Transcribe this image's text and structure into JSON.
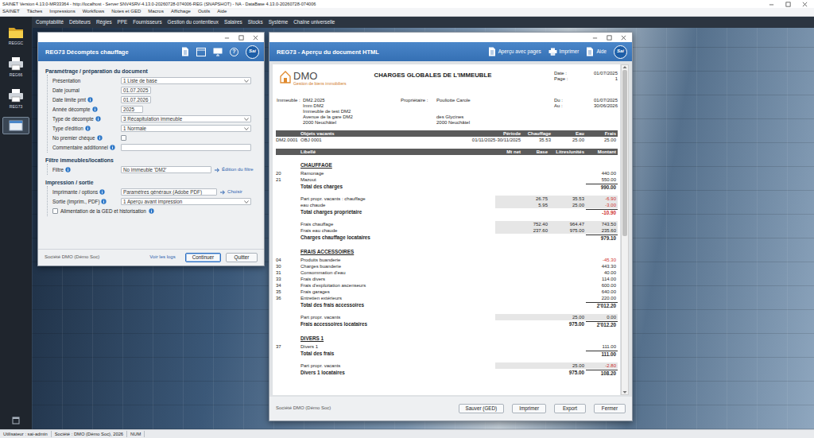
{
  "window": {
    "title": "SAINET Version 4.13.0-MR33364 - http://localhost - Server SNV4SRV-4.13.0-20260728-074006-REG (SNAPSHOT) - NA - DataBase 4.13.0-20260728-074006"
  },
  "menu_bar": [
    "SAINET",
    "Tâches",
    "Impressions",
    "Workflows",
    "Notes et GED",
    "Macros",
    "Affichage",
    "Outils",
    "Aide"
  ],
  "module_bar": [
    "Comptabilité",
    "Débiteurs",
    "Régies",
    "PPE",
    "Fournisseurs",
    "Gestion du contentieux",
    "Salaires",
    "Stocks",
    "Système",
    "Chaîne universelle"
  ],
  "sidebar": {
    "items": [
      {
        "label": "REGGC",
        "selected": false
      },
      {
        "label": "REG66",
        "selected": false
      },
      {
        "label": "REG73",
        "selected": false
      },
      {
        "selected": true
      }
    ]
  },
  "form_window": {
    "title": "REG73 Décomptes chauffage",
    "help_glyph": "?",
    "brand": "Sai",
    "sections": [
      {
        "title": "Paramétrage / préparation du document",
        "fields": [
          {
            "label": "Présentation",
            "info": false,
            "kind": "select",
            "value": "1 Liste de base"
          },
          {
            "label": "Date journal",
            "info": false,
            "kind": "date",
            "value": "01.07.2025"
          },
          {
            "label": "Date limite pmt",
            "info": true,
            "kind": "date",
            "value": "01.07.2026"
          },
          {
            "label": "Année décompte",
            "info": true,
            "kind": "year",
            "value": "2025"
          },
          {
            "label": "Type de décompte",
            "info": true,
            "kind": "select",
            "value": "3 Récapitulation immeuble"
          },
          {
            "label": "Type d'édition",
            "info": true,
            "kind": "select",
            "value": "1 Normale"
          },
          {
            "label": "No premier chèque",
            "info": true,
            "kind": "checkbox",
            "checked": false
          },
          {
            "label": "Commentaire additionnel",
            "info": true,
            "kind": "text"
          }
        ]
      },
      {
        "title": "Filtre immeubles/locations",
        "fields": [
          {
            "label": "Filtre",
            "info": true,
            "kind": "link-field",
            "value": "No immeuble 'DM2'",
            "link": "Édition du filtre"
          }
        ]
      },
      {
        "title": "Impression / sortie",
        "fields": [
          {
            "label": "Imprimante / options",
            "info": true,
            "kind": "link-field",
            "value": "Paramètres généraux (Adobe PDF)",
            "link": "Choisir"
          },
          {
            "label": "Sortie (Imprim., PDF)",
            "info": true,
            "kind": "select",
            "value": "1 Aperçu avant impression"
          },
          {
            "label": "Alimentation de la GED et historisation",
            "info": true,
            "kind": "check-label",
            "checked": false
          }
        ]
      }
    ],
    "footer": {
      "company": "Société DMO (Démo Soc)",
      "logs_link": "Voir les logs",
      "buttons": [
        {
          "label": "Continuer",
          "selected": true
        },
        {
          "label": "Quitter",
          "selected": false
        }
      ]
    }
  },
  "preview_window": {
    "title": "REG73 - Aperçu du document HTML",
    "tools": [
      "Aperçu avec pages",
      "Imprimer",
      "Aide"
    ],
    "brand": "Sai",
    "scrollbar": {
      "level": 0.52
    },
    "document": {
      "logo": {
        "name": "DMO",
        "tagline": "Gestion de biens immobiliers"
      },
      "title": "CHARGES GLOBALES DE L'IMMEUBLE",
      "meta": [
        {
          "label": "Date :",
          "value": "01/07/2025"
        },
        {
          "label": "Page :",
          "value": "1"
        }
      ],
      "building": {
        "label": "Immeuble :",
        "lines": [
          "DM2.2025",
          "Imm DM2",
          "Immeuble de test DM2",
          "Avenue de la gare DM2",
          "2000 Neuchâtel"
        ]
      },
      "owner": {
        "label": "Propriétaire :",
        "name": "Pouliotte Carole",
        "address": [
          "des Glycines",
          "2000 Neuchâtel"
        ]
      },
      "period": [
        {
          "label": "Du :",
          "value": "01/07/2025"
        },
        {
          "label": "Au :",
          "value": "30/06/2026"
        }
      ],
      "vacant_table": {
        "columns": [
          "Objets vacants",
          "Période",
          "Chauffage",
          "Eau",
          "Frais"
        ],
        "rows": [
          [
            "DM2.0001",
            "OBJ 0001",
            "01/11/2025-30/11/2025",
            "35.53",
            "25.00",
            "25.00"
          ]
        ]
      },
      "columns": [
        "Libellé",
        "Mt net",
        "Base",
        "Litres/unités",
        "Montant"
      ],
      "sections": [
        {
          "title": "CHAUFFAGE",
          "groups": [
            [
              {
                "kind": "item",
                "code": "20",
                "label": "Ramonage",
                "amount": "440.00",
                "negative": false
              },
              {
                "kind": "item",
                "code": "21",
                "label": "Mazout",
                "amount": "550.00",
                "negative": false
              },
              {
                "kind": "total",
                "label": "Total des charges",
                "amount": "990.00",
                "negative": false
              }
            ],
            [
              {
                "kind": "detail",
                "label": "Part propr. vacants : chauffage",
                "base": "26.75",
                "units": "35.53",
                "amount": "-6.90",
                "negative": true
              },
              {
                "kind": "detail",
                "label": "eau chaude",
                "base": "5.95",
                "units": "25.00",
                "amount": "-3.00",
                "negative": true
              },
              {
                "kind": "total",
                "label": "Total charges propriétaire",
                "amount": "-10.90",
                "negative": true
              }
            ],
            [
              {
                "kind": "detail",
                "label": "Frais chauffage",
                "base": "752.40",
                "units": "964.47",
                "amount": "743.50",
                "negative": false
              },
              {
                "kind": "detail",
                "label": "Frais eau chaude",
                "base": "237.60",
                "units": "975.00",
                "amount": "235.60",
                "negative": false
              },
              {
                "kind": "total",
                "label": "Charges chauffage locataires",
                "amount": "979.10",
                "negative": false
              }
            ]
          ]
        },
        {
          "title": "FRAIS ACCESSOIRES",
          "groups": [
            [
              {
                "kind": "item",
                "code": "04",
                "label": "Produits buanderie",
                "amount": "-45.30",
                "negative": true
              },
              {
                "kind": "item",
                "code": "30",
                "label": "Charges buanderie",
                "amount": "443.30",
                "negative": false
              },
              {
                "kind": "item",
                "code": "31",
                "label": "Consommation d'eau",
                "amount": "40.00",
                "negative": false
              },
              {
                "kind": "item",
                "code": "33",
                "label": "Frais divers",
                "amount": "114.00",
                "negative": false
              },
              {
                "kind": "item",
                "code": "34",
                "label": "Frais d'exploitation ascenseurs",
                "amount": "600.00",
                "negative": false
              },
              {
                "kind": "item",
                "code": "35",
                "label": "Frais garages",
                "amount": "640.00",
                "negative": false
              },
              {
                "kind": "item",
                "code": "36",
                "label": "Entretien extérieurs",
                "amount": "220.00",
                "negative": false
              },
              {
                "kind": "total",
                "label": "Total des frais accessoires",
                "amount": "2'012.20",
                "negative": false
              }
            ],
            [
              {
                "kind": "detail",
                "label": "Part propr. vacants",
                "units": "25.00",
                "amount": "0.00",
                "negative": false
              },
              {
                "kind": "total",
                "label": "Frais accessoires locataires",
                "units": "975.00",
                "amount": "2'012.20",
                "negative": false
              }
            ]
          ]
        },
        {
          "title": "DIVERS 1",
          "groups": [
            [
              {
                "kind": "item",
                "code": "37",
                "label": "Divers 1",
                "amount": "111.00",
                "negative": false
              },
              {
                "kind": "total",
                "label": "Total des frais",
                "amount": "111.00",
                "negative": false
              }
            ],
            [
              {
                "kind": "detail",
                "label": "Part propr. vacants",
                "units": "25.00",
                "amount": "-2.80",
                "negative": true
              },
              {
                "kind": "total",
                "label": "Divers 1 locataires",
                "units": "975.00",
                "amount": "108.20",
                "negative": false
              }
            ]
          ]
        }
      ]
    },
    "footer": {
      "company": "Société DMO (Démo Soc)",
      "buttons": [
        "Sauver (GED)",
        "Imprimer",
        "Export",
        "Fermer"
      ]
    }
  },
  "status_bar": [
    "Utilisateur : sai-admin",
    "Société : DMO (Démo Soc), 2026",
    "NUM"
  ]
}
